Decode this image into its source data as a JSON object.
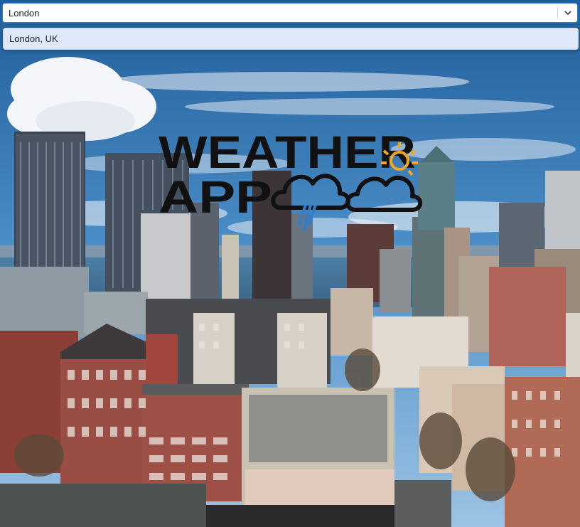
{
  "search": {
    "value": "London",
    "dropdown_icon": "chevron-down-icon"
  },
  "suggestions": [
    {
      "label": "London, UK"
    }
  ],
  "logo": {
    "line1": "WEATHER",
    "line2": "APP"
  },
  "colors": {
    "sky": "#3f80bf",
    "accent": "#2f7fd0",
    "sun": "#f2a61c",
    "rain": "#2f7fd0",
    "logo_text": "#111111"
  }
}
